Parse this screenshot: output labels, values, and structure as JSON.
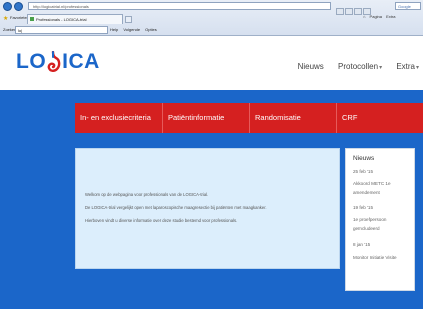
{
  "browser": {
    "address": "http://logicatrial.nl/professionals",
    "search_placeholder": "Google",
    "favorites_label": "Favorieten",
    "tab_title": "Professionals - LOGICA-trial",
    "zoek_label": "Zoeken",
    "zoek_value": "lo|",
    "toolbar_items": [
      "Help",
      "Volgende",
      "Opties"
    ],
    "right_tools": [
      "Pagina",
      "Extra"
    ]
  },
  "site": {
    "logo_lo": "LO",
    "logo_ica": "ICA",
    "nav": [
      "Nieuws",
      "Protocollen",
      "Extra"
    ],
    "red_nav": [
      "In- en exclusiecriteria",
      "Patiëntinformatie",
      "Randomisatie",
      "CRF"
    ],
    "welcome_lines": [
      "Welkom op de webpagina voor professionals van de LOGICA-trial.",
      "De LOGICA-trial vergelijkt open met laparoscopische maagresectie bij patiënten met maagkanker.",
      "Hierboven vindt u diverse informatie over deze studie bestemd voor professionals."
    ],
    "news": {
      "title": "Nieuws",
      "items": [
        {
          "date": "25 feb '15",
          "text": [
            "Akkoord METC 1e",
            "amendement"
          ]
        },
        {
          "date": "19 feb '15",
          "text": [
            "1e proefpersoon",
            "geïncludeerd"
          ]
        },
        {
          "date": "8 jan '15",
          "text": [
            "Monitor Initiatie Visite"
          ]
        }
      ]
    },
    "colors": {
      "brand_blue": "#1b66c9",
      "nav_red": "#d52020",
      "panel": "#dceefc"
    }
  }
}
